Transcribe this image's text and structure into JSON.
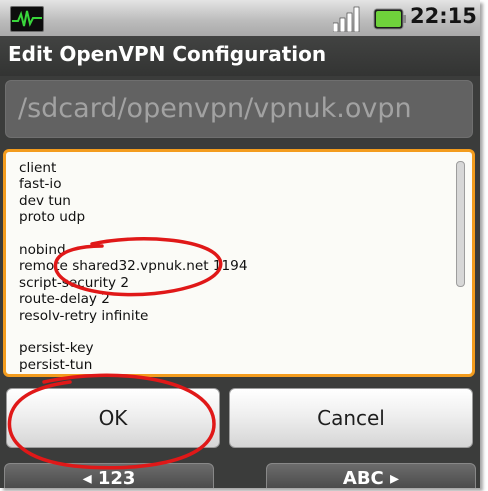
{
  "status_bar": {
    "clock": "22:15",
    "notification_icon": "activity-monitor-icon",
    "signal_icon": "signal-strength-icon",
    "battery_icon": "battery-charging-icon",
    "battery_color": "#6fd23b"
  },
  "dialog": {
    "title": "Edit OpenVPN Configuration",
    "file_path": "/sdcard/openvpn/vpnuk.ovpn",
    "config_text": "client\nfast-io\ndev tun\nproto udp\n\nnobind\nremote shared32.vpnuk.net 1194\nscript-security 2\nroute-delay 2\nresolv-retry infinite\n\npersist-key\npersist-tun",
    "ok_label": "OK",
    "cancel_label": "Cancel"
  },
  "keyboard": {
    "numeric_key": "◂ 123",
    "alpha_key": "ABC ▸"
  },
  "colors": {
    "focus_border": "#f39c1e",
    "annotation_red": "#e01818"
  }
}
